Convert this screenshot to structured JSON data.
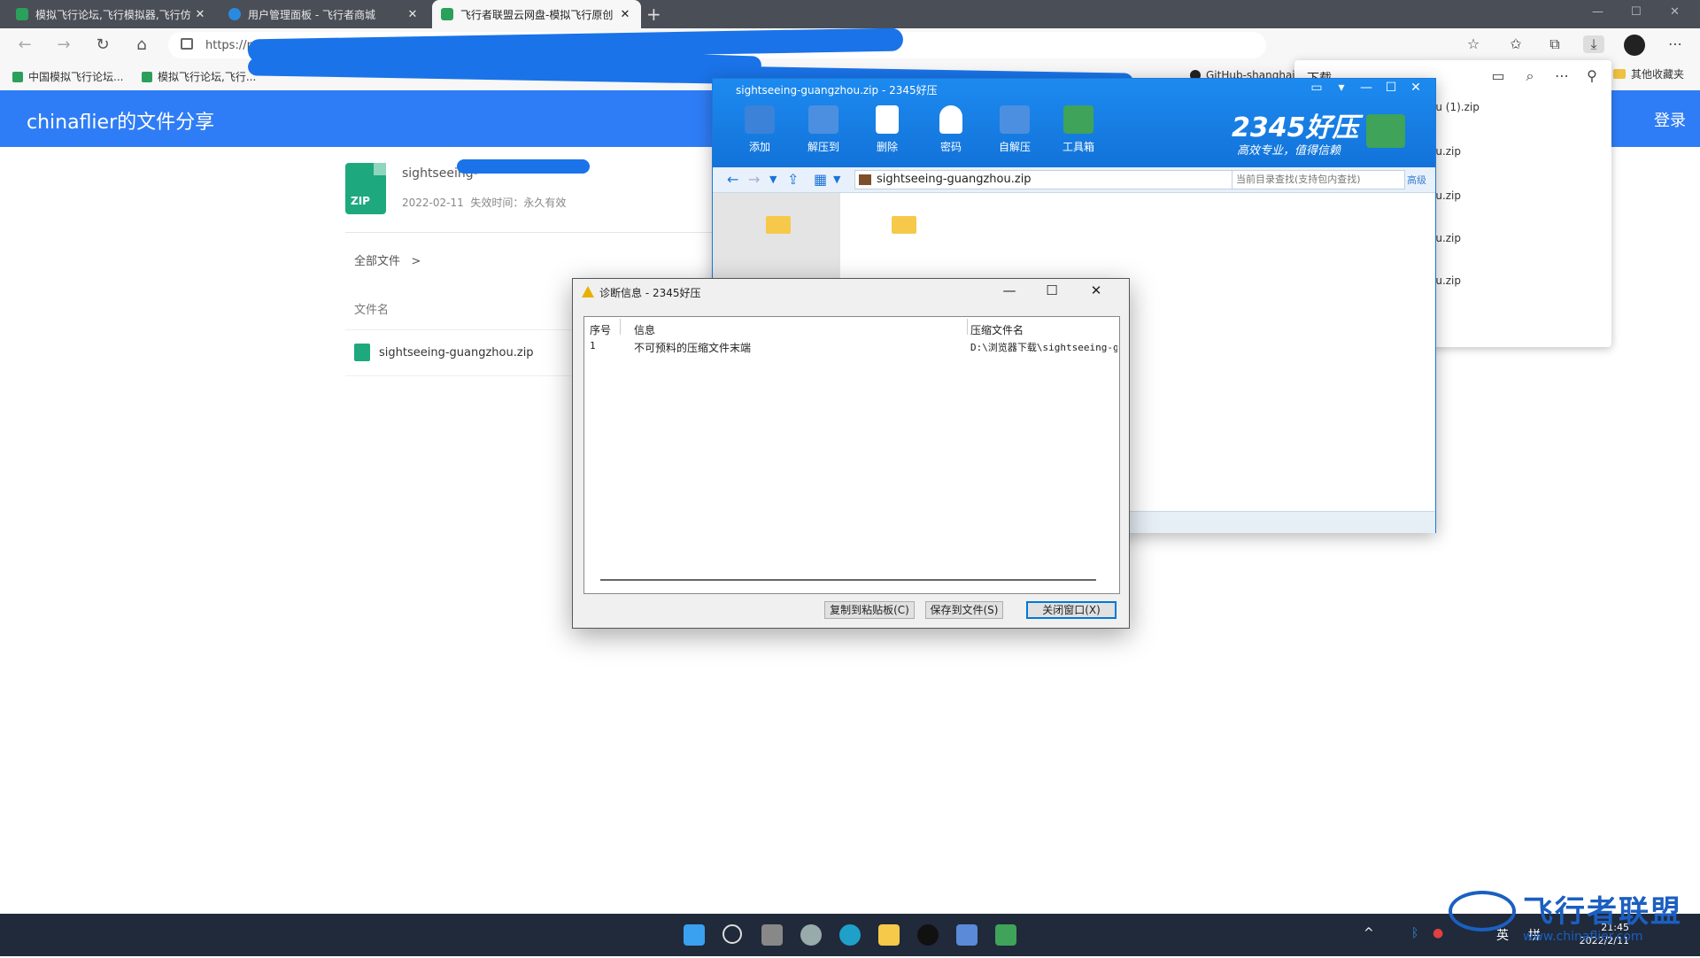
{
  "browser": {
    "tabs": [
      {
        "title": "模拟飞行论坛,飞行模拟器,飞行仿",
        "color": "#2aa05a"
      },
      {
        "title": "用户管理面板 - 飞行者商城",
        "color": "#2a8adf"
      },
      {
        "title": "飞行者联盟云网盘-模拟飞行原创",
        "color": "#2aa05a"
      }
    ],
    "url_prefix": "https://p",
    "bookmarks": [
      "中国模拟飞行论坛...",
      "模拟飞行论坛,飞行...",
      "GitHub-shanghai"
    ],
    "favorites_label": "其他收藏夹"
  },
  "downloads": {
    "title": "下载",
    "items": [
      "ou (1).zip",
      "ou.zip",
      "ou.zip",
      "ou.zip",
      "ou.zip"
    ]
  },
  "page": {
    "site_title": "chinaflier的文件分享",
    "login_label": "登录",
    "file_name_partial": "sightseeing-",
    "date": "2022-02-11",
    "expiry": "失效时间：永久有效",
    "breadcrumb": "全部文件",
    "breadcrumb_arrow": ">",
    "column_filename": "文件名",
    "file_row": "sightseeing-guangzhou.zip",
    "zip_label": "ZIP"
  },
  "archiver": {
    "title": "sightseeing-guangzhou.zip - 2345好压",
    "toolbar": [
      {
        "label": "添加",
        "color": "#3b82d8"
      },
      {
        "label": "解压到",
        "color": "#4c8fe0"
      },
      {
        "label": "删除",
        "color": "#ffffff"
      },
      {
        "label": "密码",
        "color": "#ffffff"
      },
      {
        "label": "自解压",
        "color": "#4c8fe0"
      },
      {
        "label": "工具箱",
        "color": "#3fa35a"
      }
    ],
    "brand": "2345好压",
    "slogan": "高效专业，值得信赖",
    "path": "sightseeing-guangzhou.zip",
    "search_placeholder": "当前目录查找(支持包内查找)",
    "advanced_label": "高级"
  },
  "dialog": {
    "title": "诊断信息 - 2345好压",
    "columns": [
      "序号",
      "信息",
      "压缩文件名"
    ],
    "rows": [
      {
        "index": "1",
        "message": "不可预料的压缩文件末端",
        "file": "D:\\浏览器下载\\sightseeing-guangzhou.zip"
      }
    ],
    "buttons": {
      "copy": "复制到粘贴板(C)",
      "save": "保存到文件(S)",
      "close": "关闭窗口(X)"
    }
  },
  "taskbar": {
    "ime_lang": "英",
    "ime_mode": "拼",
    "time": "21:45",
    "date": "2022/2/11"
  },
  "watermark": {
    "name": "飞行者联盟",
    "url": "www.chinaflier.com"
  }
}
